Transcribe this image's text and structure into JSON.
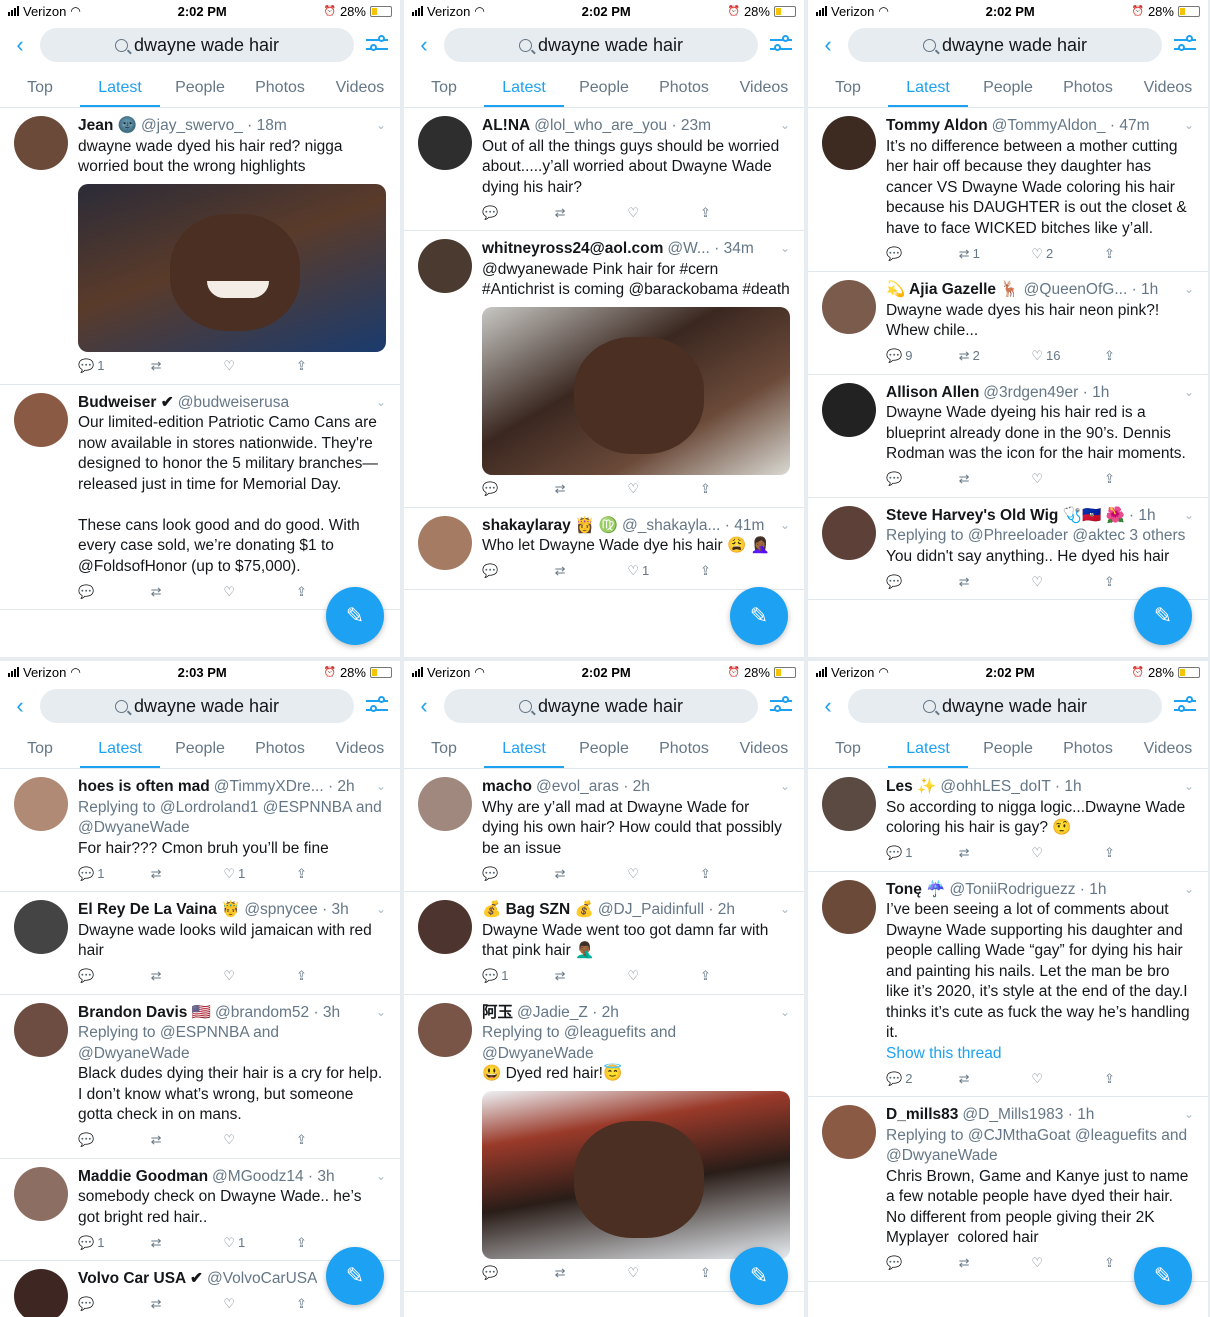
{
  "status": {
    "carrier": "Verizon",
    "battery": "28%"
  },
  "search": {
    "query": "dwayne wade hair"
  },
  "tabs": [
    "Top",
    "Latest",
    "People",
    "Photos",
    "Videos"
  ],
  "panels": [
    {
      "time": "2:02 PM",
      "tweets": [
        {
          "name": "Jean 🌚",
          "handle": "@jay_swervo_ · 18m",
          "text": "dwayne wade dyed his hair red? nigga worried bout the wrong highlights",
          "media": "smile",
          "replies": "1",
          "retweets": "",
          "likes": ""
        },
        {
          "name": "Budweiser ✔",
          "handle": "@budweiserusa",
          "text": "Our limited-edition Patriotic Camo Cans are now available in stores nationwide. They're designed to honor the 5 military branches—released just in time for Memorial Day.\n\nThese cans look good and do good. With every case sold, we’re donating $1 to @FoldsofHonor (up to $75,000).",
          "replies": "",
          "retweets": "",
          "likes": ""
        }
      ]
    },
    {
      "time": "2:02 PM",
      "tweets": [
        {
          "name": "AL!NA",
          "handle": "@lol_who_are_you · 23m",
          "text": "Out of all the things guys should be worried about.....y’all worried about Dwayne Wade dying his hair?",
          "replies": "",
          "retweets": "",
          "likes": ""
        },
        {
          "name": "whitneyross24@aol.com",
          "handle": "@W... · 34m",
          "text": "@dwyanewade Pink hair for #cern #Antichrist is coming @barackobama #death",
          "media": "pink",
          "replies": "",
          "retweets": "",
          "likes": ""
        },
        {
          "name": "shakaylaray 👸 ♍",
          "handle": "@_shakayla... · 41m",
          "text": "Who let Dwayne Wade dye his hair 😩 🤦🏾‍♀️",
          "replies": "",
          "retweets": "",
          "likes": "1"
        }
      ]
    },
    {
      "time": "2:02 PM",
      "tweets": [
        {
          "name": "Tommy Aldon",
          "handle": "@TommyAldon_ · 47m",
          "text": "It’s no difference between a mother cutting her hair off because they daughter has cancer VS Dwayne Wade coloring his hair because his DAUGHTER is out the closet & have to face WICKED bitches like y’all.",
          "replies": "",
          "retweets": "1",
          "likes": "2"
        },
        {
          "name": "💫 Ajia Gazelle 🦌",
          "handle": "@QueenOfG... · 1h",
          "text": "Dwayne wade dyes his hair neon pink?! Whew chile...",
          "replies": "9",
          "retweets": "2",
          "likes": "16"
        },
        {
          "name": "Allison Allen",
          "handle": "@3rdgen49er · 1h",
          "text": "Dwayne Wade dyeing his hair red is a blueprint already done in the 90’s. Dennis Rodman was the icon for the hair moments.",
          "replies": "",
          "retweets": "",
          "likes": ""
        },
        {
          "name": "Steve Harvey's Old Wig 🩺🇭🇹 🌺",
          "handle": "· 1h",
          "reply_to": "Replying to @Phreeloader @aktec 3 others",
          "text": "You didn't say anything.. He dyed his hair",
          "replies": "",
          "retweets": "",
          "likes": ""
        }
      ]
    },
    {
      "time": "2:03 PM",
      "tweets": [
        {
          "name": "hoes is often mad",
          "handle": "@TimmyXDre... · 2h",
          "reply_to": "Replying to @Lordroland1 @ESPNNBA and @DwyaneWade",
          "text": "For hair??? Cmon bruh you’ll be fine",
          "replies": "1",
          "retweets": "",
          "likes": "1"
        },
        {
          "name": "El Rey De La Vaina 🤴",
          "handle": "@spnycee · 3h",
          "text": "Dwayne wade looks wild jamaican with red hair",
          "replies": "",
          "retweets": "",
          "likes": ""
        },
        {
          "name": "Brandon Davis 🇺🇸",
          "handle": "@brandom52 · 3h",
          "reply_to": "Replying to @ESPNNBA and @DwyaneWade",
          "text": "Black dudes dying their hair is a cry for help.  I don’t know what’s wrong, but someone gotta check in on mans.",
          "replies": "",
          "retweets": "",
          "likes": ""
        },
        {
          "name": "Maddie Goodman",
          "handle": "@MGoodz14 · 3h",
          "text": "somebody check on Dwayne Wade.. he’s got bright red hair..",
          "replies": "1",
          "retweets": "",
          "likes": "1"
        },
        {
          "name": "Volvo Car USA ✔",
          "handle": "@VolvoCarUSA",
          "text": "",
          "replies": "",
          "retweets": "",
          "likes": ""
        }
      ]
    },
    {
      "time": "2:02 PM",
      "tweets": [
        {
          "name": "macho",
          "handle": "@evol_aras · 2h",
          "text": "Why are y’all mad at Dwayne Wade for dying his own hair? How could that possibly be an issue",
          "replies": "",
          "retweets": "",
          "likes": ""
        },
        {
          "name": "💰 Bag SZN 💰",
          "handle": "@DJ_Paidinfull · 2h",
          "text": "Dwayne Wade went too got damn far with that pink hair 🤦🏾‍♂️",
          "replies": "1",
          "retweets": "",
          "likes": ""
        },
        {
          "name": "阿玉",
          "handle": "@Jadie_Z · 2h",
          "reply_to": "Replying to @leaguefits and @DwyaneWade",
          "text": "😃 Dyed red hair!😇",
          "media": "red",
          "replies": "",
          "retweets": "",
          "likes": ""
        }
      ]
    },
    {
      "time": "2:02 PM",
      "tweets": [
        {
          "name": "Les ✨",
          "handle": "@ohhLES_doIT · 1h",
          "text": "So according to nigga logic...Dwayne Wade coloring his hair is gay? 🤨",
          "replies": "1",
          "retweets": "",
          "likes": ""
        },
        {
          "name": "Tonę ☔",
          "handle": "@ToniiRodriguezz · 1h",
          "text": "I’ve been seeing a lot of comments about Dwayne Wade supporting his daughter and people calling Wade “gay” for dying his hair and painting his nails. Let the man be bro like it’s 2020, it’s style at the end of the day.I thinks it’s cute as fuck the way he’s handling it.",
          "replies": "2",
          "retweets": "",
          "likes": "",
          "extra_link": "Show this thread"
        },
        {
          "name": "D_mills83",
          "handle": "@D_Mills1983 · 1h",
          "reply_to": "Replying to @CJMthaGoat @leaguefits and @DwyaneWade",
          "text": "Chris Brown, Game and Kanye just to name a few notable people have dyed their hair. No different from people giving their 2K Myplayer  colored hair",
          "replies": "",
          "retweets": "",
          "likes": ""
        }
      ]
    }
  ],
  "colors": {
    "accent": "#1da1f2",
    "muted": "#657786",
    "divider": "#e1e8ed"
  }
}
